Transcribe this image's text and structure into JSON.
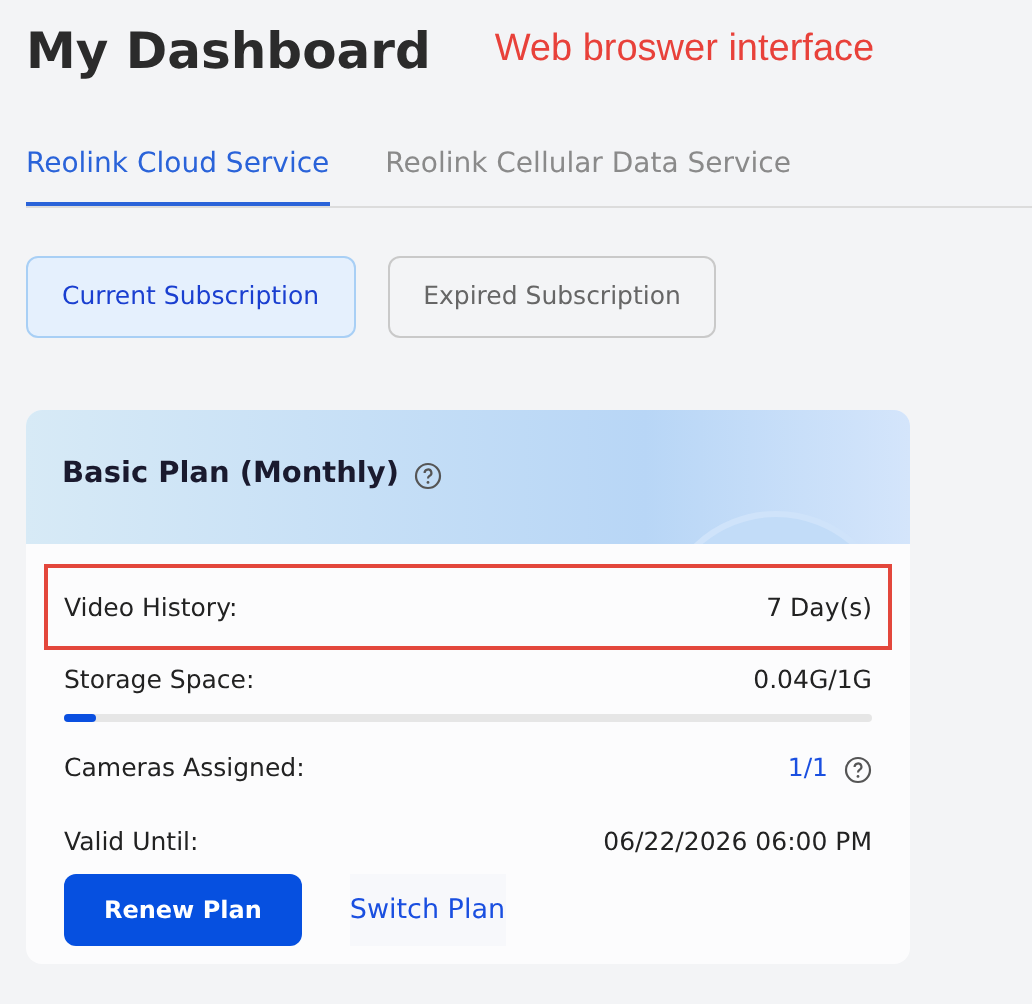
{
  "page_title": "My Dashboard",
  "annotation": "Web broswer interface",
  "tabs": [
    {
      "label": "Reolink Cloud Service",
      "selected": true
    },
    {
      "label": "Reolink Cellular Data Service",
      "selected": false
    }
  ],
  "filters": [
    {
      "label": "Current Subscription",
      "selected": true
    },
    {
      "label": "Expired Subscription",
      "selected": false
    }
  ],
  "plan": {
    "title": "Basic Plan (Monthly)",
    "help": true,
    "rows": [
      {
        "kind": "text",
        "label": "Video History:",
        "value": "7 Day(s)",
        "highlighted": true
      },
      {
        "kind": "meter",
        "label": "Storage Space:",
        "value": "0.04G/1G",
        "level": 0.04,
        "highlighted": false
      },
      {
        "kind": "link",
        "label": "Cameras Assigned:",
        "value": "1/1",
        "help": true,
        "highlighted": false
      },
      {
        "kind": "text",
        "label": "Valid Until:",
        "value": "06/22/2026 06:00 PM",
        "highlighted": false
      }
    ],
    "buttons": [
      {
        "kind": "primary",
        "label": "Renew Plan"
      },
      {
        "kind": "link",
        "label": "Switch Plan"
      }
    ]
  }
}
